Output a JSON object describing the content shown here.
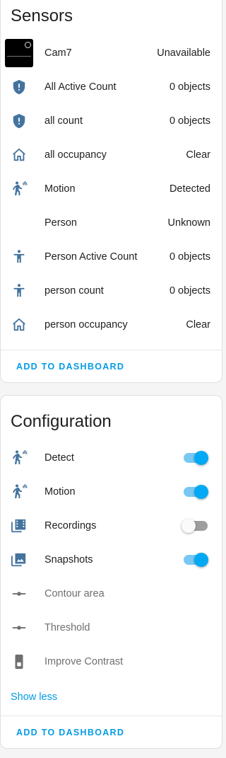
{
  "colors": {
    "icon": "#44739e",
    "accent": "#039be5",
    "toggle_on": "#03a9f4"
  },
  "sensors": {
    "title": "Sensors",
    "rows": [
      {
        "label": "Cam7",
        "value": "Unavailable",
        "icon": "camera-thumbnail"
      },
      {
        "label": "All Active Count",
        "value": "0 objects",
        "icon": "shield-alert-icon"
      },
      {
        "label": "all count",
        "value": "0 objects",
        "icon": "shield-alert-icon"
      },
      {
        "label": "all occupancy",
        "value": "Clear",
        "icon": "home-outline-icon"
      },
      {
        "label": "Motion",
        "value": "Detected",
        "icon": "motion-sensor-icon"
      },
      {
        "label": "Person",
        "value": "Unknown",
        "icon": ""
      },
      {
        "label": "Person Active Count",
        "value": "0 objects",
        "icon": "human-icon"
      },
      {
        "label": "person count",
        "value": "0 objects",
        "icon": "human-icon"
      },
      {
        "label": "person occupancy",
        "value": "Clear",
        "icon": "home-outline-icon"
      }
    ],
    "action": "ADD TO DASHBOARD"
  },
  "configuration": {
    "title": "Configuration",
    "rows": [
      {
        "label": "Detect",
        "state": "on",
        "icon": "motion-sensor-icon"
      },
      {
        "label": "Motion",
        "state": "on",
        "icon": "motion-sensor-icon"
      },
      {
        "label": "Recordings",
        "state": "off",
        "icon": "filmstrip-box-icon"
      },
      {
        "label": "Snapshots",
        "state": "on",
        "icon": "image-multiple-icon"
      },
      {
        "label": "Contour area",
        "icon": "slider-icon"
      },
      {
        "label": "Threshold",
        "icon": "slider-icon"
      },
      {
        "label": "Improve Contrast",
        "icon": "switch-rectangle-icon"
      }
    ],
    "show_less": "Show less",
    "action": "ADD TO DASHBOARD"
  }
}
